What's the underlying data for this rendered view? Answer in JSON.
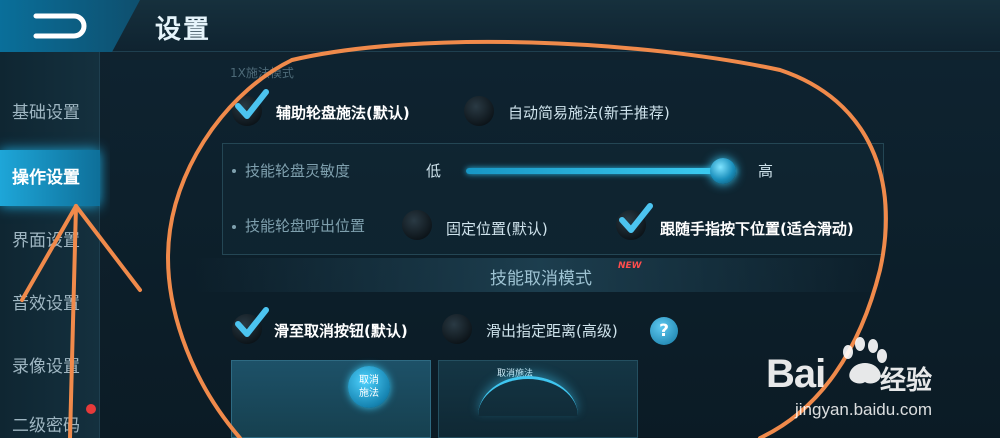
{
  "header": {
    "title": "设置"
  },
  "sidebar": {
    "items": [
      {
        "label": "基础设置"
      },
      {
        "label": "操作设置"
      },
      {
        "label": "界面设置"
      },
      {
        "label": "音效设置"
      },
      {
        "label": "录像设置"
      },
      {
        "label": "二级密码"
      }
    ],
    "active_index": 1
  },
  "cast_mode": {
    "faint_label": "1X施法模式",
    "option_assist": "辅助轮盘施法(默认)",
    "option_auto": "自动简易施法(新手推荐)",
    "selected": "option_assist"
  },
  "wheel_settings": {
    "sensitivity_label": "技能轮盘灵敏度",
    "low": "低",
    "high": "高",
    "sensitivity_level": 0.95,
    "position_label": "技能轮盘呼出位置",
    "option_fixed": "固定位置(默认)",
    "option_follow": "跟随手指按下位置(适合滑动)",
    "selected": "option_follow"
  },
  "cancel_mode": {
    "title": "技能取消模式",
    "badge": "NEW",
    "option_button": "滑至取消按钮(默认)",
    "option_distance": "滑出指定距离(高级)",
    "help": "?",
    "selected": "option_button",
    "preview1_label": "取消\n施法",
    "preview2_label": "取消施法"
  },
  "watermark": {
    "brand": "Bai",
    "brand_cn": "经验",
    "url": "jingyan.baidu.com"
  },
  "colors": {
    "accent": "#1ea6d8",
    "annotation": "#f08a4b",
    "badge": "#ff4d4d"
  }
}
